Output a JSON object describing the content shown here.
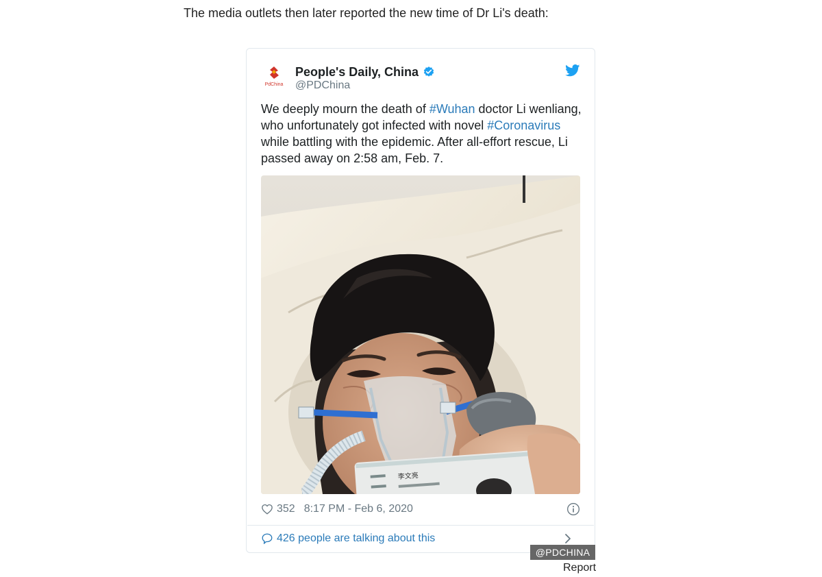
{
  "article": {
    "intro_text": "The media outlets then later reported the new time of Dr Li's death:"
  },
  "tweet": {
    "author_name": "People's Daily, China",
    "author_handle": "@PDChina",
    "avatar_text": "PdChina",
    "text_parts": {
      "p1": "We deeply mourn the death of ",
      "tag1": "#Wuhan",
      "p2": " doctor Li wenliang, who unfortunately got infected with novel ",
      "tag2": "#Coronavirus",
      "p3": " while battling with the epidemic. After all-effort rescue, Li passed away on 2:58 am, Feb. 7."
    },
    "likes": "352",
    "timestamp": "8:17 PM - Feb 6, 2020",
    "talking": "426 people are talking about this",
    "photo_id_card_text": "李文亮",
    "colors": {
      "link": "#2b7bb9",
      "muted": "#697882",
      "border": "#e1e8ed",
      "twitter_blue": "#1da1f2"
    },
    "icons": [
      "verified-icon",
      "twitter-logo-icon",
      "heart-icon",
      "info-icon",
      "bubble-icon",
      "chevron-right-icon"
    ]
  },
  "image_credit": "@PDCHINA",
  "report_label": "Report"
}
